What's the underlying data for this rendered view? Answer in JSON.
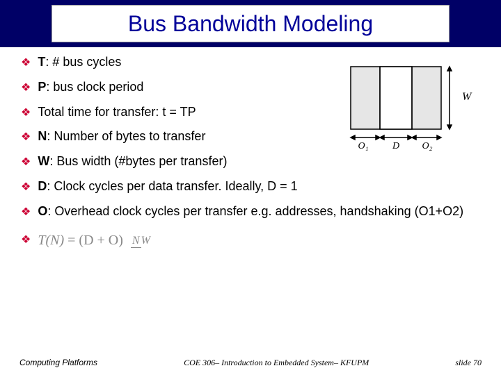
{
  "title": "Bus Bandwidth Modeling",
  "bullets": [
    {
      "sym": "T",
      "rest": ": # bus cycles"
    },
    {
      "sym": "P",
      "rest": ": bus clock period"
    },
    {
      "sym": "",
      "rest": "Total time for transfer: t = TP"
    },
    {
      "sym": "N",
      "rest": ": Number of bytes to transfer"
    },
    {
      "sym": "W",
      "rest": ": Bus width (#bytes per transfer)"
    },
    {
      "sym": "D",
      "rest": ": Clock cycles per data transfer. Ideally, D = 1"
    },
    {
      "sym": "O",
      "rest": ": Overhead clock cycles per transfer e.g. addresses, handshaking (O1+O2)"
    }
  ],
  "formula": {
    "lhs": "T(N)",
    "eq": " = (D + O) ",
    "num": "N",
    "den": "W"
  },
  "diagram": {
    "labels": {
      "o1": "O₁",
      "d": "D",
      "o2": "O₂",
      "w": "W"
    }
  },
  "footer": {
    "left": "Computing Platforms",
    "mid": "COE 306– Introduction to Embedded System– KFUPM",
    "right": "slide 70"
  }
}
